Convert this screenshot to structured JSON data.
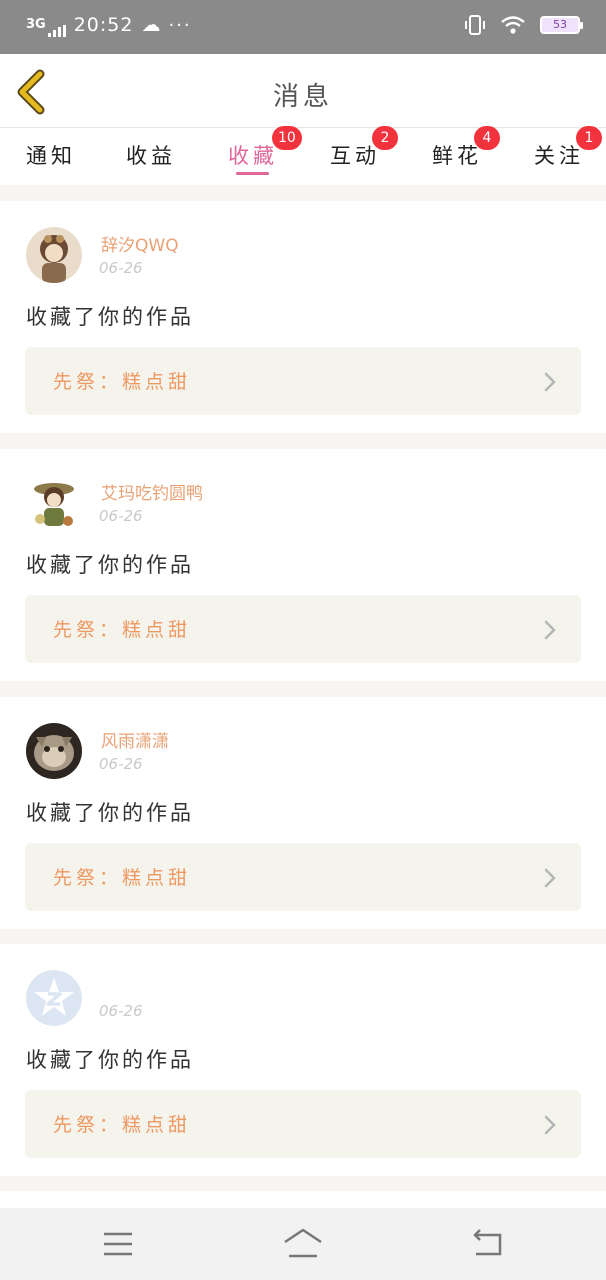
{
  "status_bar": {
    "network": "3G",
    "time": "20:52",
    "more": "···",
    "battery": "53"
  },
  "header": {
    "title": "消息"
  },
  "tabs": [
    {
      "label": "通知",
      "badge": ""
    },
    {
      "label": "收益",
      "badge": ""
    },
    {
      "label": "收藏",
      "badge": "10",
      "active": true
    },
    {
      "label": "互动",
      "badge": "2"
    },
    {
      "label": "鲜花",
      "badge": "4"
    },
    {
      "label": "关注",
      "badge": "1"
    }
  ],
  "messages": [
    {
      "username": "辞汐QWQ",
      "date": "06-26",
      "action": "收藏了你的作品",
      "work": "先祭：糕点甜",
      "avatar": "avatar-anime-character-icon"
    },
    {
      "username": "艾玛吃钓圆鸭",
      "date": "06-26",
      "action": "收藏了你的作品",
      "work": "先祭：糕点甜",
      "avatar": "avatar-anime-character-icon"
    },
    {
      "username": "风雨潇潇",
      "date": "06-26",
      "action": "收藏了你的作品",
      "work": "先祭：糕点甜",
      "avatar": "avatar-cat-photo-icon"
    },
    {
      "username": "",
      "date": "06-26",
      "action": "收藏了你的作品",
      "work": "先祭：糕点甜",
      "avatar": "avatar-qq-default-icon"
    }
  ],
  "colors": {
    "accent": "#e0679a",
    "badge": "#f2333e",
    "username": "#e9a276",
    "work_title": "#ee9963",
    "back_arrow": "#e6b91f"
  }
}
